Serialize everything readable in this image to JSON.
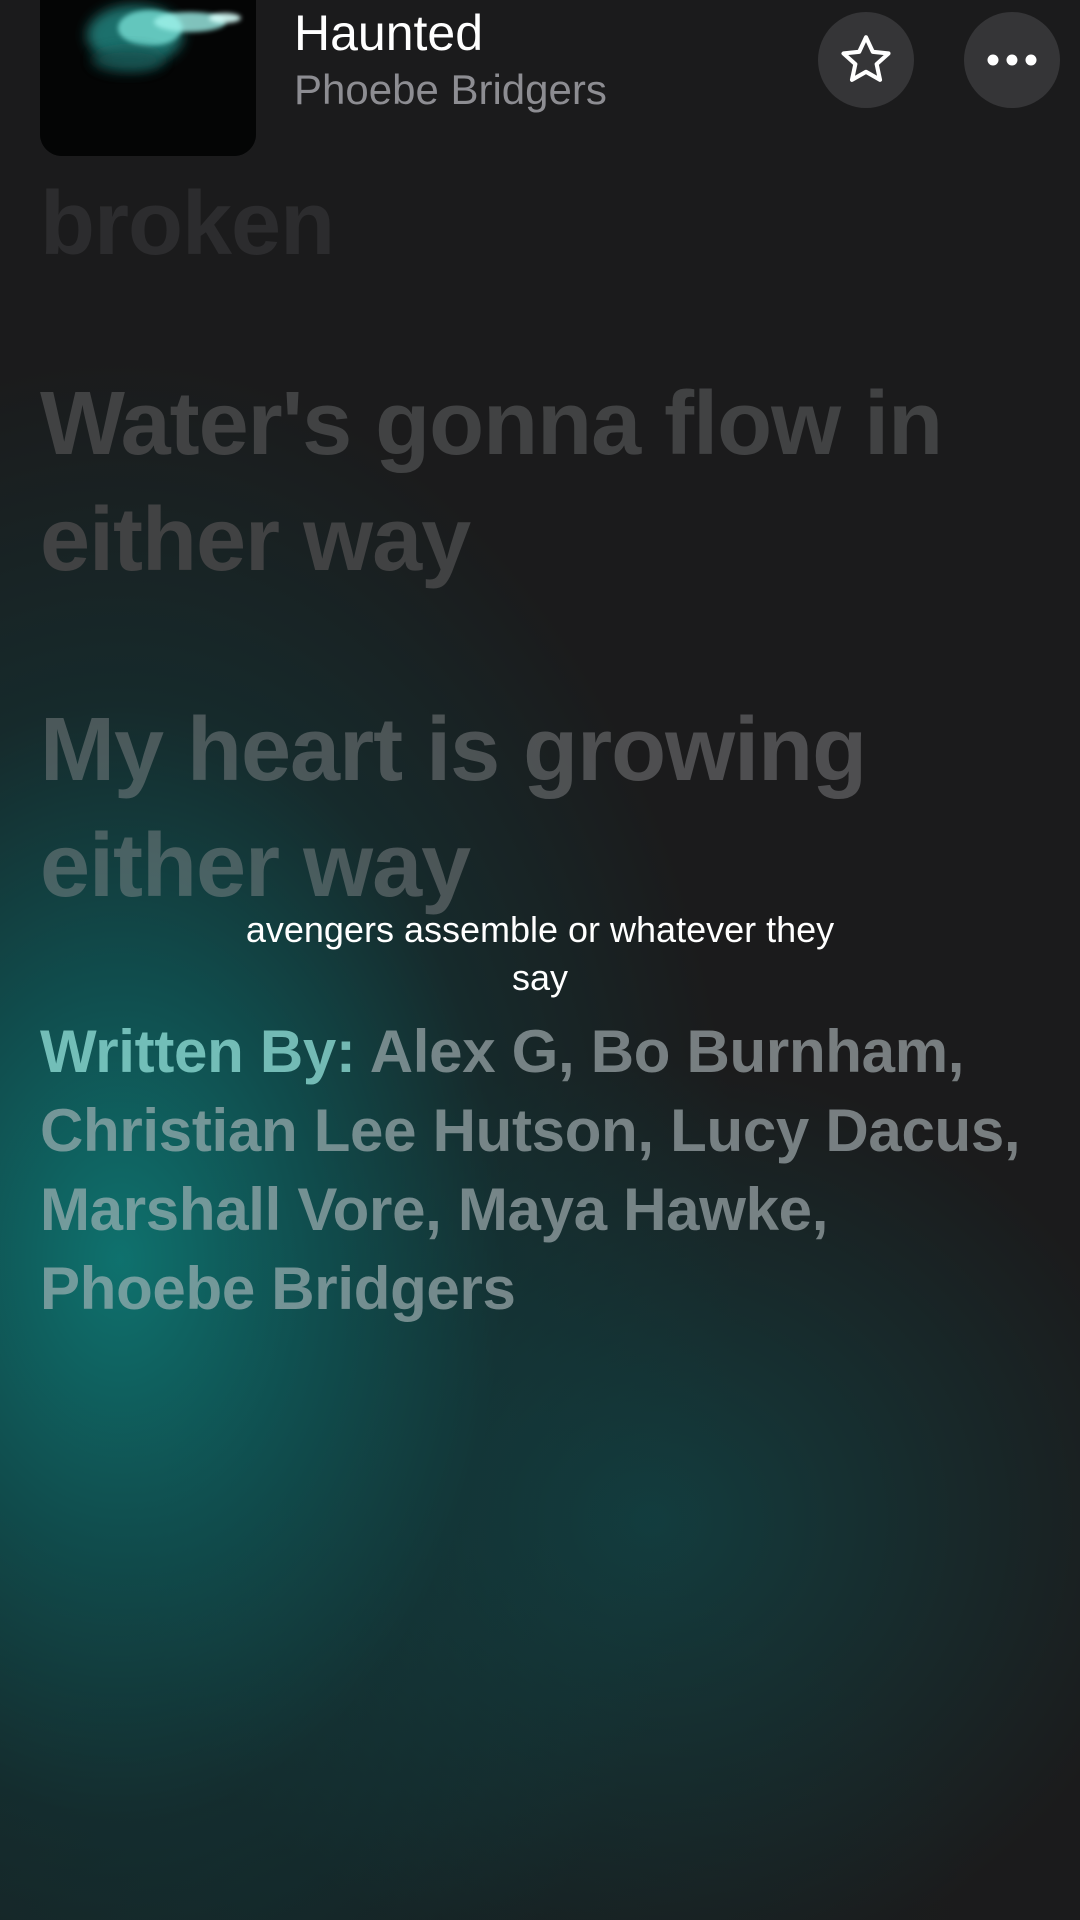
{
  "now_playing": {
    "title": "Haunted",
    "artist": "Phoebe Bridgers",
    "artwork_icon": "album-artwork",
    "favorite_icon": "star-icon",
    "more_icon": "more-icon"
  },
  "lyrics": {
    "line_broken": "broken",
    "line_water": "Water's gonna flow in either way",
    "line_heart": "My heart is growing either way"
  },
  "caption": {
    "text": "avengers assemble or whatever they say"
  },
  "credits": {
    "label": "Written By:",
    "names": " Alex G, Bo Burnham, Christian Lee Hutson, Lucy Dacus, Marshall Vore, Maya Hawke, Phoebe Bridgers"
  },
  "colors": {
    "background": "#1b1b1c",
    "accent_teal": "#0e7672",
    "title": "#ffffff",
    "artist": "#8d8d92"
  }
}
